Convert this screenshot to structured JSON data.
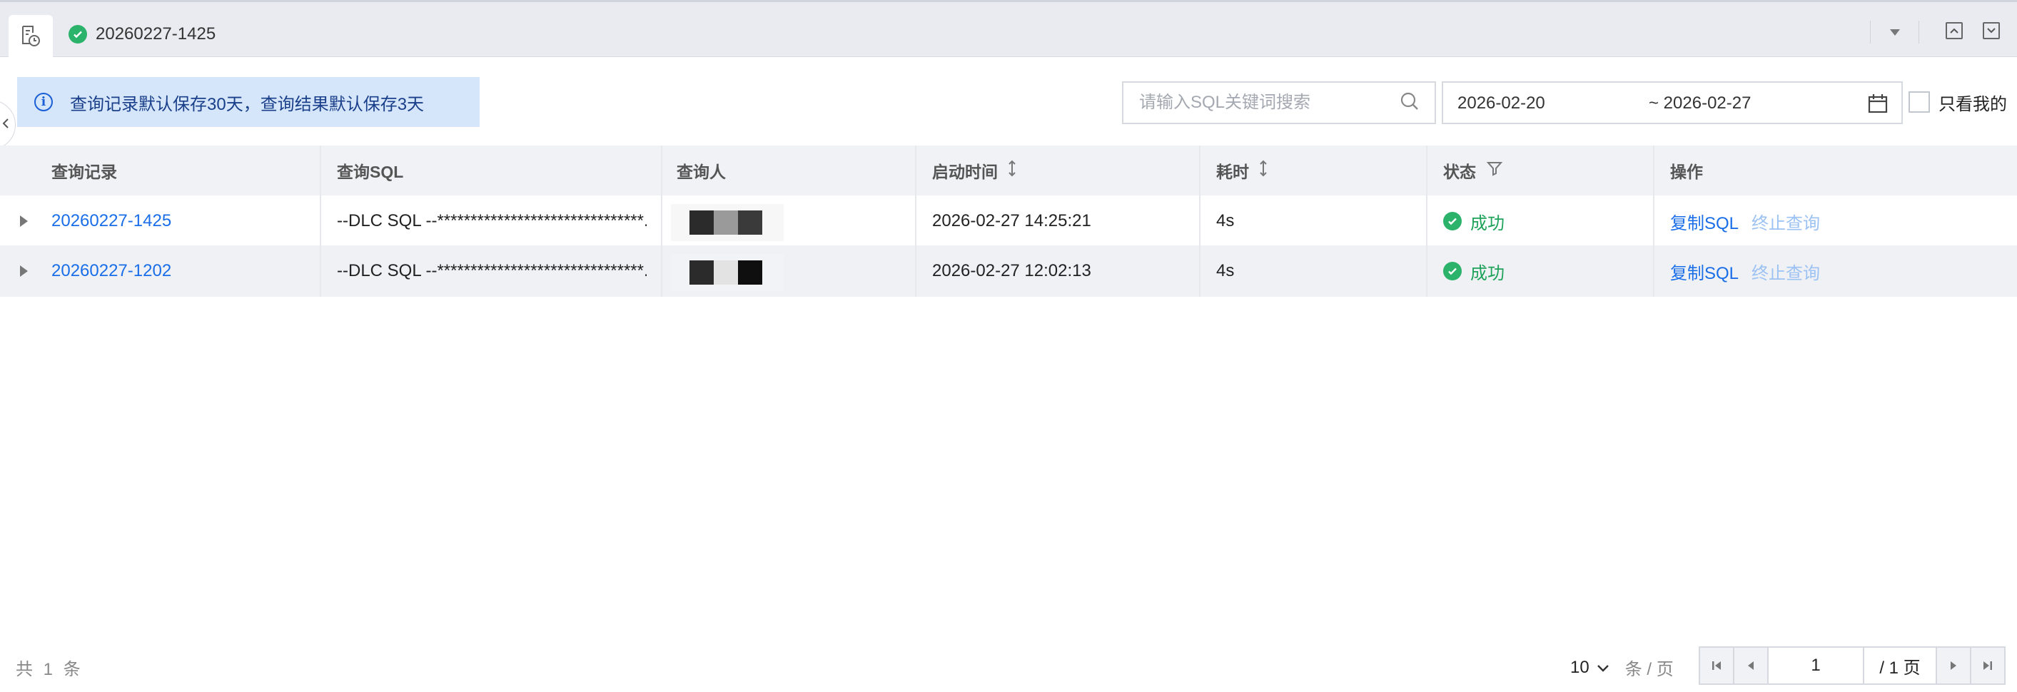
{
  "tabs": {
    "active_title": "20260227-1425"
  },
  "notice": {
    "text": "查询记录默认保存30天，查询结果默认保存3天"
  },
  "search": {
    "placeholder": "请输入SQL关键词搜索",
    "value": ""
  },
  "date_range": {
    "start": "2026-02-20",
    "end": "~ 2026-02-27"
  },
  "only_mine": {
    "label": "只看我的",
    "checked": false
  },
  "table": {
    "columns": [
      "查询记录",
      "查询SQL",
      "查询人",
      "启动时间",
      "耗时",
      "状态",
      "操作"
    ],
    "rows": [
      {
        "record": "20260227-1425",
        "sql": "--DLC SQL --*******************************...",
        "start_time": "2026-02-27 14:25:21",
        "duration": "4s",
        "status": "成功",
        "action_copy": "复制SQL",
        "action_stop": "终止查询"
      },
      {
        "record": "20260227-1202",
        "sql": "--DLC SQL --*******************************...",
        "start_time": "2026-02-27 12:02:13",
        "duration": "4s",
        "status": "成功",
        "action_copy": "复制SQL",
        "action_stop": "终止查询"
      }
    ]
  },
  "footer": {
    "total": "共 1 条",
    "page_size": "10",
    "page_size_unit": "条 / 页",
    "current_page": "1",
    "total_pages": "/ 1 页"
  },
  "colors": {
    "accent": "#1a6ee8",
    "success": "#1ea25a",
    "notice_bg": "#d5e6fb"
  }
}
